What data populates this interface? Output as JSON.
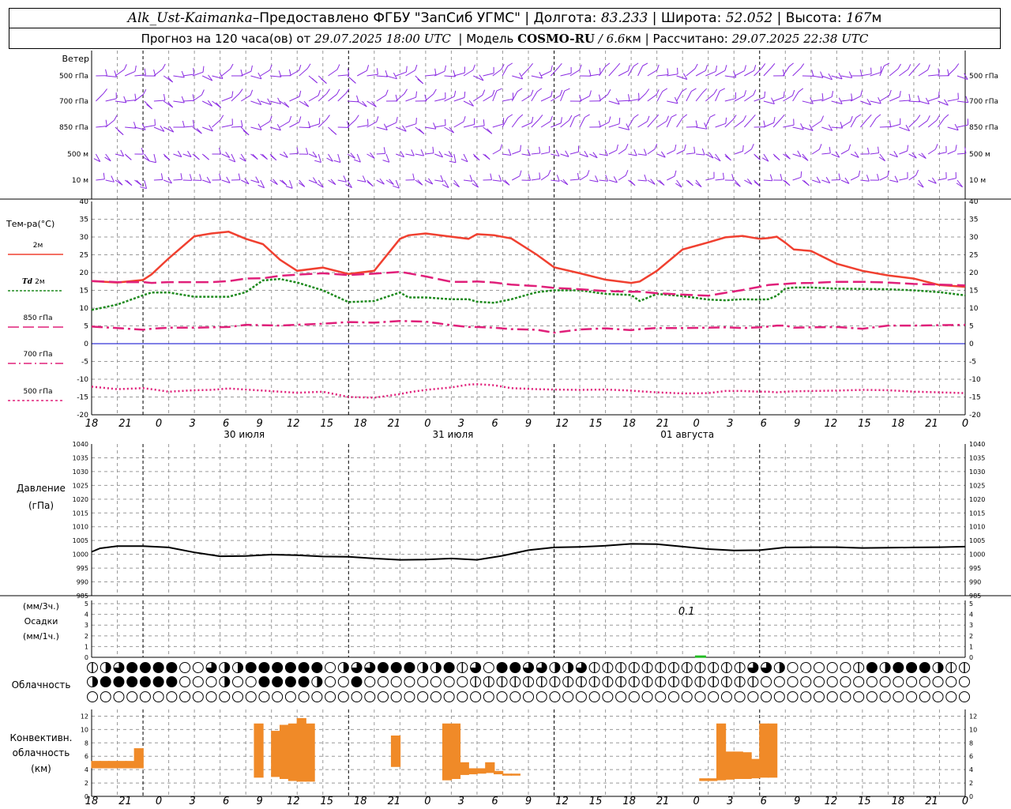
{
  "header": {
    "station": "Alk_Ust-Kaimanka",
    "dash": " – ",
    "provider": "Предоставлено ФГБУ \"ЗапСиб УГМС\"",
    "lon_label": "Долгота:",
    "lon_value": "83.233",
    "lat_label": "Широта:",
    "lat_value": "52.052",
    "alt_label": "Высота:",
    "alt_value": "167",
    "alt_unit": "м",
    "forecast_label": "Прогноз на 120 часа(ов) от",
    "forecast_time": "29.07.2025 18:00 UTC",
    "model_label": "Модель",
    "model_name": "COSMO-RU",
    "model_res": "/ 6.6",
    "model_res_unit": "км",
    "calc_label": "Рассчитано:",
    "calc_time": "29.07.2025 22:38 UTC",
    "sep": "|"
  },
  "colors": {
    "t2m": "#f04030",
    "td2m": "#1e8a1e",
    "t850": "#e0207a",
    "t700": "#e0207a",
    "t500": "#e0207a",
    "wind": "#8a2be2",
    "zero_line": "#0000cc",
    "pressure": "#000000",
    "precip": "#22bb22",
    "convective": "#f08a28",
    "grid": "#999999"
  },
  "time_axis": {
    "tick_labels": [
      "18",
      "21",
      "0",
      "3",
      "6",
      "9",
      "12",
      "15",
      "18",
      "21",
      "0",
      "3",
      "6",
      "9",
      "12",
      "15",
      "18",
      "21",
      "0",
      "3",
      "6",
      "9",
      "12",
      "15",
      "18",
      "21",
      "0"
    ],
    "date_labels": [
      "30 июля",
      "31 июля",
      "01 августа"
    ]
  },
  "wind_panel": {
    "title": "Ветер",
    "levels": [
      "500 гПа",
      "700 гПа",
      "850 гПа",
      "500 м",
      "10 м"
    ]
  },
  "temperature_panel": {
    "title": "Тем-ра(°С)",
    "legend": [
      {
        "label": "2м",
        "style": "solid"
      },
      {
        "label_italic": "Td",
        "label": "2м",
        "style": "dotted"
      },
      {
        "label": "850 гПа",
        "style": "dash"
      },
      {
        "label": "700 гПа",
        "style": "dashdot"
      },
      {
        "label": "500 гПа",
        "style": "dot"
      }
    ],
    "y_ticks": [
      "40",
      "35",
      "30",
      "25",
      "20",
      "15",
      "10",
      "5",
      "0",
      "-5",
      "-10",
      "-15",
      "-20"
    ]
  },
  "pressure_panel": {
    "title": "Давление",
    "unit": "(гПа)",
    "y_ticks": [
      "1040",
      "1035",
      "1030",
      "1025",
      "1020",
      "1015",
      "1010",
      "1005",
      "1000",
      "995",
      "990",
      "985"
    ]
  },
  "precip_panel": {
    "unit1": "(мм/3ч.)",
    "title": "Осадки",
    "unit2": "(мм/1ч.)",
    "y_ticks": [
      "5",
      "4",
      "3",
      "2",
      "1",
      "0"
    ],
    "annotation": "0.1"
  },
  "cloud_panel": {
    "title": "Облачность",
    "rows": [
      "1234444003224444440233444224130443322311111111111133200000142444211",
      "2444444000200444420040000000011111111111111111111110000000000000000",
      "0000000000000000000000000000000000000000000000000000000000000000000"
    ]
  },
  "convective_panel": {
    "title1": "Конвективн.",
    "title2": "облачность",
    "unit": "(км)",
    "y_ticks": [
      "12",
      "10",
      "8",
      "6",
      "4",
      "2",
      "0"
    ]
  },
  "chart_data": [
    {
      "type": "line",
      "title": "Тем-ра(°С)",
      "x": [
        -6,
        -3,
        0,
        1,
        3,
        6,
        8,
        10,
        12,
        14,
        16,
        18,
        21,
        24,
        27,
        30,
        31,
        33,
        36,
        38,
        39,
        41,
        43,
        46,
        48,
        51,
        54,
        57,
        58,
        60,
        63,
        66,
        68,
        70,
        72,
        73,
        74,
        75,
        76,
        78,
        81,
        84,
        87,
        90,
        93,
        96
      ],
      "ylim": [
        -20,
        40
      ],
      "series": [
        {
          "name": "2м",
          "values": [
            17.6,
            17.2,
            17.9,
            19.5,
            24,
            30.2,
            31,
            31.5,
            29.5,
            28,
            23.6,
            20.5,
            21.4,
            19.6,
            20.5,
            29.5,
            30.5,
            31,
            30.1,
            29.5,
            30.8,
            30.5,
            29.6,
            25,
            21.5,
            19.8,
            18,
            17.1,
            17.5,
            20.5,
            26.5,
            28.5,
            29.9,
            30.3,
            29.5,
            29.7,
            30.1,
            28.4,
            26.5,
            26.1,
            22.5,
            20.5,
            19.2,
            18.3,
            16.5,
            16
          ]
        },
        {
          "name": "Td 2м",
          "values": [
            9.5,
            11,
            13.6,
            14.4,
            14.4,
            13.2,
            13.2,
            13.2,
            14.5,
            17.8,
            18.2,
            17.2,
            15,
            11.7,
            12,
            14.4,
            13,
            13,
            12.5,
            12.5,
            11.8,
            11.5,
            12.5,
            14.5,
            15,
            15,
            14,
            13.7,
            12,
            14,
            13.4,
            12.4,
            12.2,
            12.5,
            12.4,
            12.5,
            13.5,
            15.5,
            15.8,
            15.8,
            15.5,
            15.4,
            15.3,
            15,
            14.5,
            13.6
          ]
        },
        {
          "name": "850 гПа",
          "values": [
            17.6,
            17.3,
            17.3,
            17.1,
            17.3,
            17.3,
            17.3,
            17.6,
            18.3,
            18.4,
            19.1,
            19.4,
            19.8,
            19.3,
            19.7,
            20.2,
            19.8,
            18.9,
            17.4,
            17.4,
            17.5,
            17.2,
            16.6,
            16.2,
            15.7,
            15.3,
            14.8,
            14.6,
            14.6,
            14.2,
            13.8,
            13.5,
            14.3,
            15.1,
            16,
            16.5,
            16.7,
            16.8,
            17,
            17.1,
            17.4,
            17.4,
            17.2,
            16.8,
            16.6,
            16.4
          ]
        },
        {
          "name": "700 гПа",
          "values": [
            4.8,
            4.4,
            3.9,
            4.2,
            4.5,
            4.5,
            4.6,
            4.7,
            5.3,
            5.2,
            5.1,
            5.3,
            5.6,
            6.1,
            5.9,
            6.4,
            6.3,
            6.2,
            5.2,
            4.7,
            4.7,
            4.5,
            4.1,
            3.9,
            3.1,
            4,
            4.3,
            3.8,
            4.1,
            4.4,
            4.4,
            4.5,
            4.6,
            4.4,
            4.6,
            4.8,
            5.1,
            5.1,
            4.5,
            4.6,
            4.7,
            4.2,
            5.1,
            5.1,
            5.2,
            5.3
          ]
        },
        {
          "name": "500 гПа",
          "values": [
            -12.1,
            -12.8,
            -12.5,
            -12.8,
            -13.5,
            -13.1,
            -13,
            -12.6,
            -12.9,
            -13.2,
            -13.5,
            -13.8,
            -13.5,
            -15,
            -15.2,
            -14.2,
            -13.7,
            -13,
            -12.3,
            -11.5,
            -11.4,
            -11.7,
            -12.5,
            -12.8,
            -12.9,
            -13,
            -12.9,
            -13.2,
            -13.4,
            -13.7,
            -14,
            -13.9,
            -13.3,
            -13.3,
            -13.5,
            -13.5,
            -13.7,
            -13.5,
            -13.4,
            -13.3,
            -13.2,
            -13,
            -13.1,
            -13.5,
            -13.7,
            -13.9
          ]
        }
      ]
    },
    {
      "type": "line",
      "title": "Давление",
      "x": [
        -6,
        -5,
        -3,
        0,
        3,
        6,
        9,
        12,
        15,
        18,
        21,
        24,
        27,
        30,
        33,
        36,
        39,
        42,
        45,
        48,
        51,
        54,
        57,
        60,
        63,
        66,
        69,
        72,
        75,
        78,
        81,
        84,
        87,
        90,
        93,
        96
      ],
      "ylim": [
        985,
        1040
      ],
      "series": [
        {
          "name": "Давление",
          "values": [
            1000.9,
            1002.2,
            1003,
            1003,
            1002.5,
            1000.7,
            999.3,
            999.4,
            999.9,
            999.7,
            999.2,
            999.1,
            998.5,
            998,
            998.1,
            998.5,
            998,
            999.5,
            1001.5,
            1002.5,
            1002.7,
            1003.1,
            1003.8,
            1003.7,
            1002.8,
            1001.9,
            1001.4,
            1001.5,
            1002.5,
            1002.6,
            1002.6,
            1002.3,
            1002.4,
            1002.5,
            1002.6,
            1002.8
          ]
        }
      ]
    },
    {
      "type": "bar",
      "title": "Осадки",
      "x": [
        65
      ],
      "values": [
        0.1
      ],
      "ylim": [
        0,
        5
      ]
    },
    {
      "type": "bar",
      "title": "Конвективн. облачность",
      "ylim": [
        0,
        13
      ],
      "bars": [
        {
          "x": -5,
          "bottom": 4.2,
          "top": 5.3
        },
        {
          "x": -4,
          "bottom": 4.2,
          "top": 5.3
        },
        {
          "x": -3,
          "bottom": 4.2,
          "top": 5.3
        },
        {
          "x": -2,
          "bottom": 4.2,
          "top": 5.3
        },
        {
          "x": -1,
          "bottom": 4.2,
          "top": 5.3
        },
        {
          "x": 0,
          "bottom": 4.2,
          "top": 7.2
        },
        {
          "x": 14,
          "bottom": 2.8,
          "top": 10.9
        },
        {
          "x": 16,
          "bottom": 2.9,
          "top": 9.8
        },
        {
          "x": 17,
          "bottom": 2.6,
          "top": 10.7
        },
        {
          "x": 18,
          "bottom": 2.3,
          "top": 10.9
        },
        {
          "x": 19,
          "bottom": 2.2,
          "top": 11.7
        },
        {
          "x": 20,
          "bottom": 2.2,
          "top": 10.9
        },
        {
          "x": 30,
          "bottom": 4.4,
          "top": 9.1
        },
        {
          "x": 36,
          "bottom": 2.4,
          "top": 10.9
        },
        {
          "x": 37,
          "bottom": 2.6,
          "top": 10.9
        },
        {
          "x": 38,
          "bottom": 3.2,
          "top": 5.1
        },
        {
          "x": 39,
          "bottom": 3.3,
          "top": 4.2
        },
        {
          "x": 40,
          "bottom": 3.4,
          "top": 4.2
        },
        {
          "x": 41,
          "bottom": 3.5,
          "top": 5.1
        },
        {
          "x": 42,
          "bottom": 3.3,
          "top": 3.8
        },
        {
          "x": 43,
          "bottom": 3.1,
          "top": 3.4
        },
        {
          "x": 44,
          "bottom": 3.1,
          "top": 3.4
        },
        {
          "x": 66,
          "bottom": 2.3,
          "top": 2.7
        },
        {
          "x": 67,
          "bottom": 2.3,
          "top": 2.7
        },
        {
          "x": 68,
          "bottom": 2.4,
          "top": 10.9
        },
        {
          "x": 69,
          "bottom": 2.5,
          "top": 6.7
        },
        {
          "x": 70,
          "bottom": 2.6,
          "top": 6.7
        },
        {
          "x": 71,
          "bottom": 2.6,
          "top": 6.6
        },
        {
          "x": 72,
          "bottom": 2.7,
          "top": 5.6
        },
        {
          "x": 73,
          "bottom": 2.8,
          "top": 10.9
        },
        {
          "x": 74,
          "bottom": 2.8,
          "top": 10.9
        }
      ]
    }
  ]
}
